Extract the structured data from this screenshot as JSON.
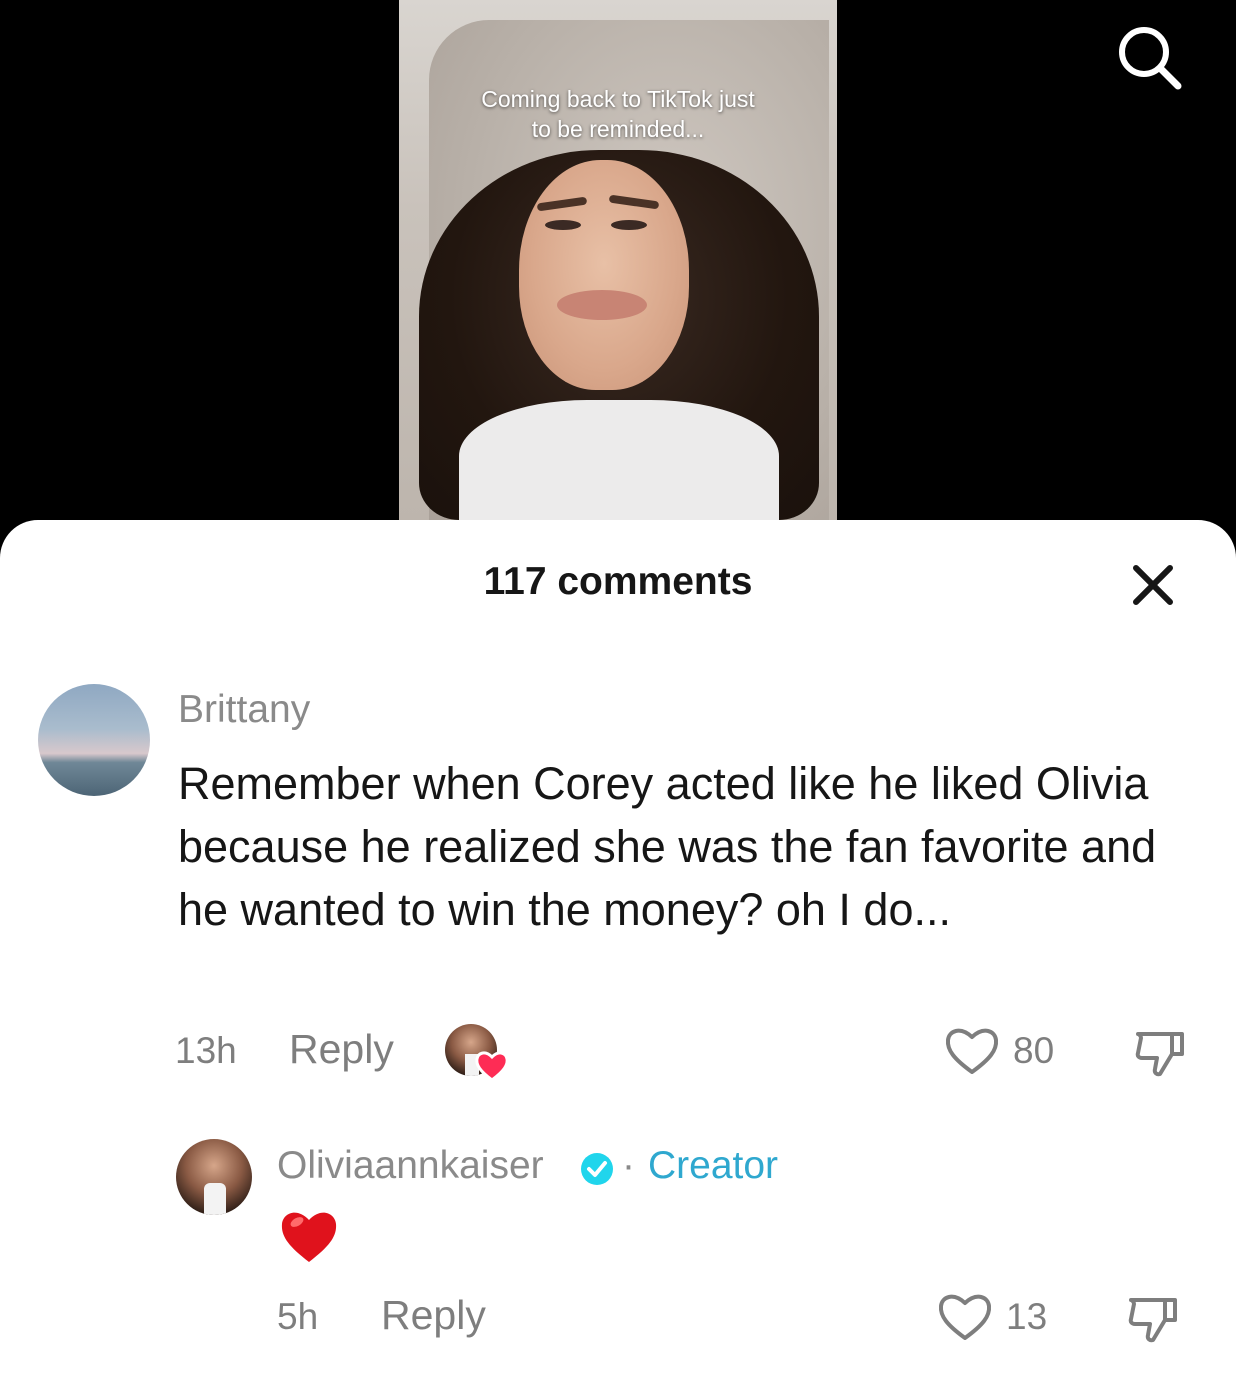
{
  "video": {
    "caption_line1": "Coming back to TikTok just",
    "caption_line2": "to be reminded..."
  },
  "icons": {
    "search": "search-icon",
    "close": "close-icon",
    "heart": "heart-outline-icon",
    "dislike": "thumbs-down-icon",
    "verified": "verified-badge-icon",
    "red_heart": "red-heart-emoji"
  },
  "colors": {
    "creator_accent": "#2fa8cf",
    "like_heart": "#fe2c55",
    "muted_text": "#8a8a8a"
  },
  "comments_sheet": {
    "title": "117 comments",
    "comments": [
      {
        "username": "Brittany",
        "text": "Remember when Corey acted like he liked Olivia because he realized she was the fan favorite and he wanted to win the money? oh I do...",
        "time": "13h",
        "reply_label": "Reply",
        "likes": "80",
        "liked_by_creator": true
      },
      {
        "username": "Oliviaannkaiser",
        "separator": "·",
        "badge": "Creator",
        "text": "❤️",
        "time": "5h",
        "reply_label": "Reply",
        "likes": "13"
      }
    ]
  }
}
